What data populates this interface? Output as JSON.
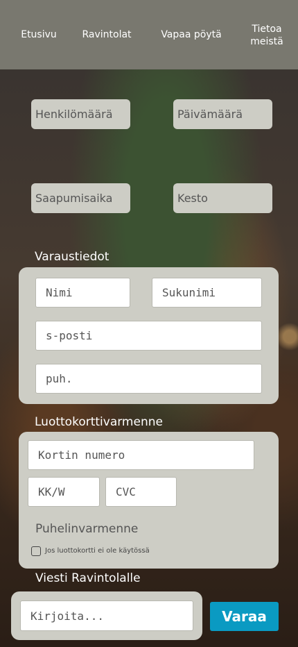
{
  "nav": {
    "items": [
      {
        "label": "Etusivu"
      },
      {
        "label": "Ravintolat"
      },
      {
        "label": "Vapaa pöytä"
      },
      {
        "label": "Tietoa\nmeistä"
      }
    ]
  },
  "booking": {
    "guests": "Henkilömäärä",
    "date": "Päivämäärä",
    "arrival": "Saapumisaika",
    "duration": "Kesto"
  },
  "reservation": {
    "title": "Varaustiedot",
    "first_name_placeholder": "Nimi",
    "last_name_placeholder": "Sukunimi",
    "email_placeholder": "s-posti",
    "phone_placeholder": "puh."
  },
  "credit_card": {
    "title": "Luottokorttivarmenne",
    "number_placeholder": "Kortin numero",
    "expiry_placeholder": "KK/W",
    "cvc_placeholder": "CVC",
    "phone_verification_title": "Puhelinvarmenne",
    "checkbox_label": "Jos luottokortti ei ole käytössä"
  },
  "message": {
    "title": "Viesti Ravintolalle",
    "placeholder": "Kirjoita..."
  },
  "submit_label": "Varaa",
  "colors": {
    "nav_bg": "#79786f",
    "panel_bg": "#cdcdc5",
    "accent": "#0a9ac2"
  }
}
